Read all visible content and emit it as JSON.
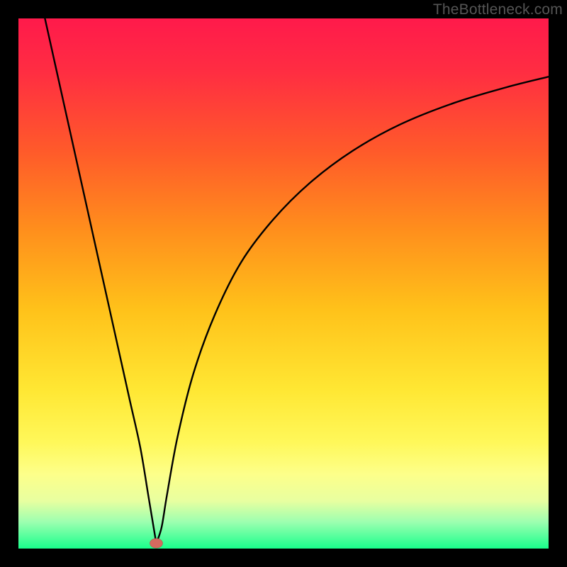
{
  "watermark": "TheBottleneck.com",
  "colors": {
    "bg_black": "#000000",
    "curve": "#000000",
    "marker_fill": "#d46a5f",
    "marker_stroke": "#b3564c"
  },
  "chart_data": {
    "type": "line",
    "title": "",
    "xlabel": "",
    "ylabel": "",
    "xlim": [
      0,
      100
    ],
    "ylim": [
      0,
      100
    ],
    "grid": false,
    "legend": false,
    "gradient_stops": [
      {
        "offset": 0.0,
        "color": "#ff1a4b"
      },
      {
        "offset": 0.1,
        "color": "#ff2d42"
      },
      {
        "offset": 0.25,
        "color": "#ff5a2a"
      },
      {
        "offset": 0.4,
        "color": "#ff8f1c"
      },
      {
        "offset": 0.55,
        "color": "#ffc21a"
      },
      {
        "offset": 0.7,
        "color": "#ffe733"
      },
      {
        "offset": 0.8,
        "color": "#fff85a"
      },
      {
        "offset": 0.86,
        "color": "#fdff8a"
      },
      {
        "offset": 0.91,
        "color": "#e8ffa0"
      },
      {
        "offset": 0.95,
        "color": "#9cffb0"
      },
      {
        "offset": 1.0,
        "color": "#19ff8c"
      }
    ],
    "series": [
      {
        "name": "left-branch",
        "x": [
          5,
          7,
          9,
          11,
          13,
          15,
          17,
          19,
          21,
          23,
          24.5,
          25.5,
          26
        ],
        "y": [
          100,
          91,
          82,
          73,
          64,
          55,
          46,
          37,
          28,
          19,
          10,
          4,
          1
        ]
      },
      {
        "name": "right-branch",
        "x": [
          26,
          27,
          28,
          30,
          33,
          37,
          42,
          48,
          55,
          63,
          72,
          82,
          92,
          100
        ],
        "y": [
          1,
          4,
          10,
          21,
          33,
          44,
          54,
          62,
          69,
          75,
          80,
          84,
          87,
          89
        ]
      }
    ],
    "marker": {
      "x": 26,
      "y": 1,
      "rx": 1.2,
      "ry": 0.9
    }
  }
}
